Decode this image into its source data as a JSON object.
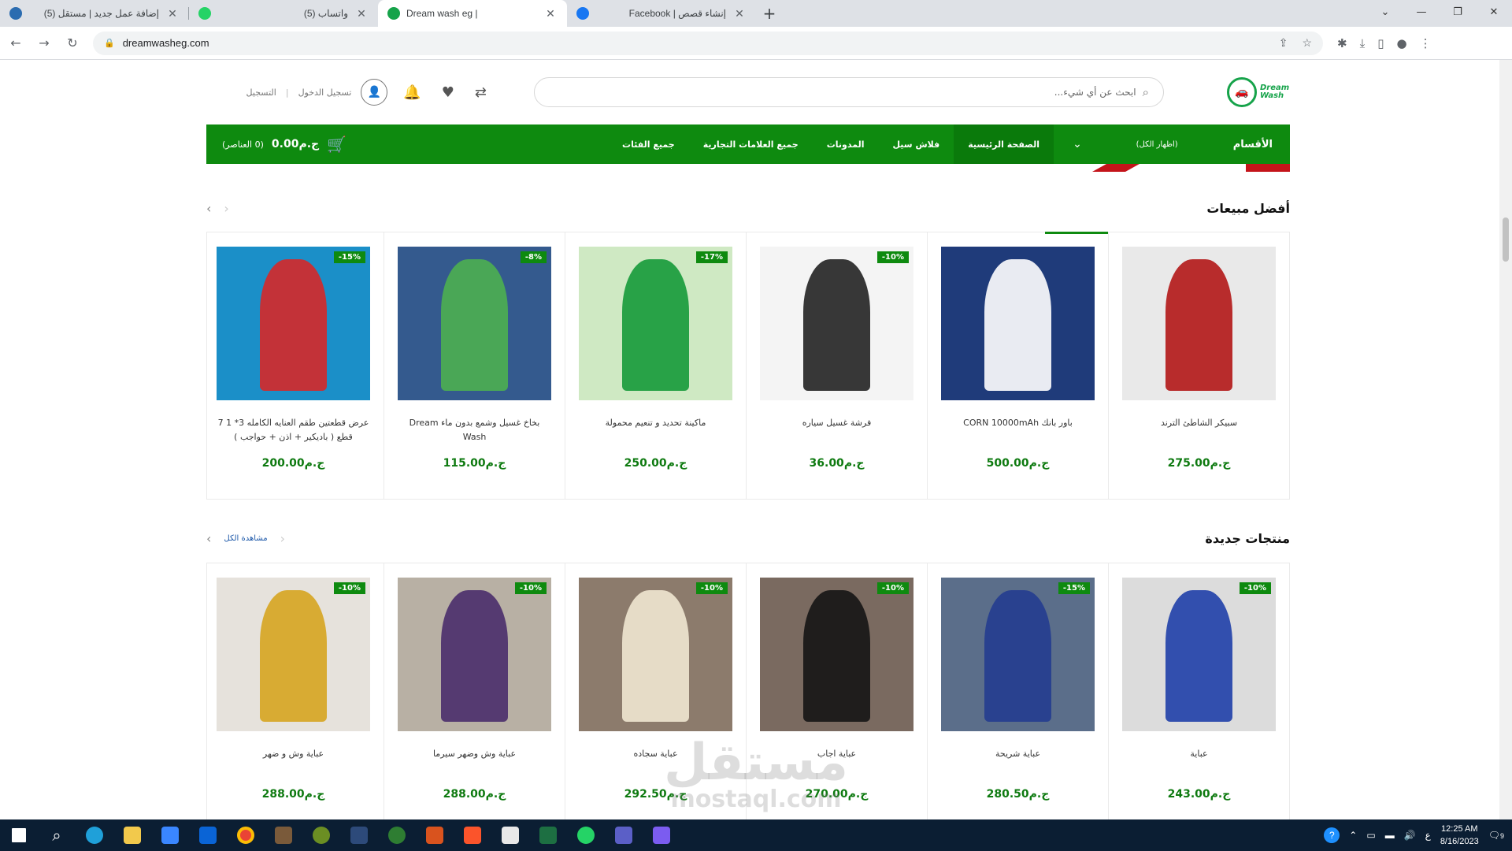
{
  "browser": {
    "tabs": [
      {
        "title": "إضافة عمل جديد | مستقل (5)",
        "color": "#2b6cb0"
      },
      {
        "title": "واتساب (5)",
        "color": "#25d366"
      },
      {
        "title": "Dream wash eg |",
        "color": "#16a34a"
      },
      {
        "title": "إنشاء قصص | Facebook",
        "color": "#1877f2"
      }
    ],
    "url": "dreamwasheg.com"
  },
  "header": {
    "logo_line1": "Dream",
    "logo_line2": "Wash",
    "search_placeholder": "ابحث عن أي شيء...",
    "login": "تسجيل الدخول",
    "register": "التسجيل"
  },
  "nav": {
    "categories_title": "الأقسام",
    "show_all": "(اظهار الكل)",
    "items": [
      {
        "label": "الصفحة الرئيسية"
      },
      {
        "label": "فلاش سيل"
      },
      {
        "label": "المدونات"
      },
      {
        "label": "جميع العلامات التجارية"
      },
      {
        "label": "جميع الفئات"
      }
    ],
    "cart_amount": "ج.م0.00",
    "cart_count": "(0 العناصر)"
  },
  "best_sellers": {
    "title": "أفضل مبيعات",
    "products": [
      {
        "name": "سبيكر الشاطئ الترند",
        "price": "ج.م275.00",
        "discount": "",
        "bg": "#e9e9e9",
        "fg": "#b31717"
      },
      {
        "name": "باور بانك CORN 10000mAh",
        "price": "ج.م500.00",
        "discount": "",
        "bg": "#1f3b7a",
        "fg": "#ffffff"
      },
      {
        "name": "فرشة غسيل سياره",
        "price": "ج.م36.00",
        "discount": "-10%",
        "bg": "#f4f4f4",
        "fg": "#222222"
      },
      {
        "name": "ماكينة تحديد و تنعيم محمولة",
        "price": "ج.م250.00",
        "discount": "-17%",
        "bg": "#cfe9c3",
        "fg": "#159a3a"
      },
      {
        "name": "بخاخ غسيل وشمع بدون ماء Dream Wash",
        "price": "ج.م115.00",
        "discount": "-8%",
        "bg": "#345a8e",
        "fg": "#4caf50"
      },
      {
        "name": "عرض قطعتين طقم العنايه الكامله 3* 1 7 قطع ( باديكير + اذن + حواجب )",
        "price": "ج.م200.00",
        "discount": "-15%",
        "bg": "#1b8fc8",
        "fg": "#d62828"
      }
    ]
  },
  "new_products": {
    "title": "منتجات جديدة",
    "view_all": "مشاهدة الكل",
    "products": [
      {
        "name": "عباية",
        "price": "ج.م243.00",
        "discount": "-10%",
        "bg": "#dcdcdc",
        "fg": "#1f3fa8"
      },
      {
        "name": "عباية شريحة",
        "price": "ج.م280.50",
        "discount": "-15%",
        "bg": "#5b6e8a",
        "fg": "#233c8f"
      },
      {
        "name": "عباية اجاب",
        "price": "ج.م270.00",
        "discount": "-10%",
        "bg": "#7a6a60",
        "fg": "#151515"
      },
      {
        "name": "عباية سجاده",
        "price": "ج.م292.50",
        "discount": "-10%",
        "bg": "#8c7b6c",
        "fg": "#efe7d2"
      },
      {
        "name": "عباية وش وضهر سيرما",
        "price": "ج.م288.00",
        "discount": "-10%",
        "bg": "#b8b0a4",
        "fg": "#4a2d6b"
      },
      {
        "name": "عباية وش و ضهر",
        "price": "ج.م288.00",
        "discount": "-10%",
        "bg": "#e6e2dc",
        "fg": "#d6a520"
      }
    ]
  },
  "watermark": {
    "line1": "مستقل",
    "line2": "mostaql.com"
  },
  "taskbar": {
    "time": "12:25 AM",
    "date": "8/16/2023",
    "lang": "ع",
    "notif": "9"
  }
}
